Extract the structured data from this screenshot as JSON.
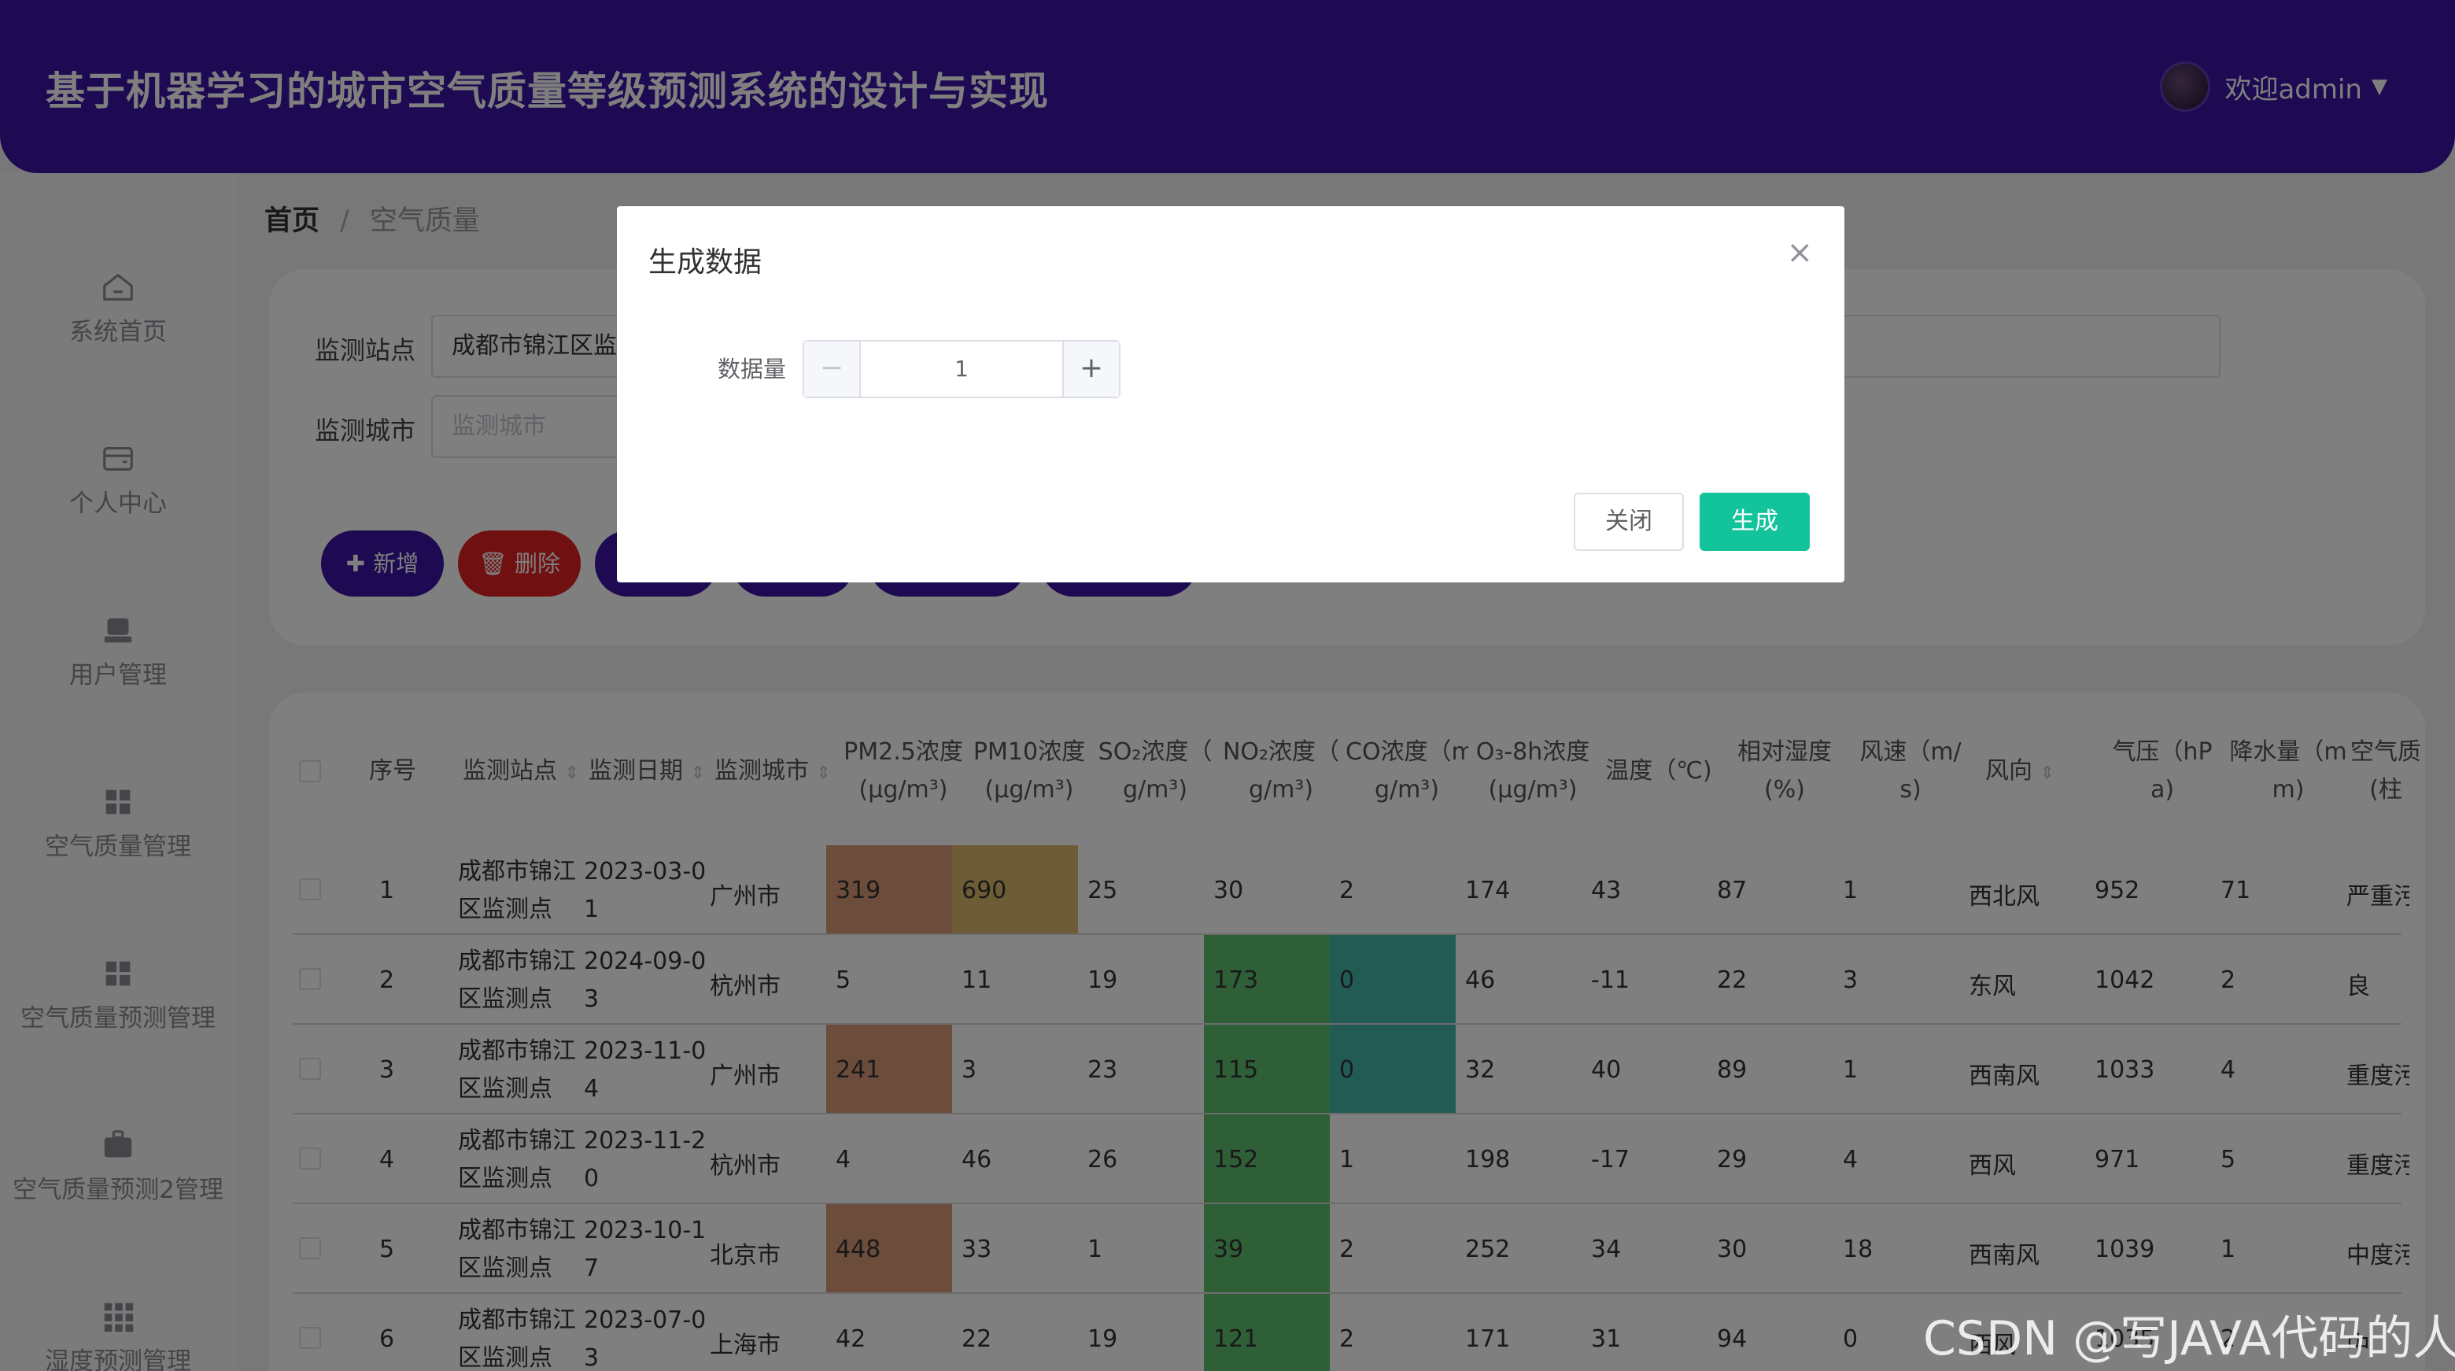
{
  "header": {
    "title": "基于机器学习的城市空气质量等级预测系统的设计与实现",
    "welcome": "欢迎admin",
    "caret": "▼"
  },
  "sidebar": {
    "items": [
      {
        "label": "系统首页",
        "icon": "home-icon"
      },
      {
        "label": "个人中心",
        "icon": "wallet-icon"
      },
      {
        "label": "用户管理",
        "icon": "user-icon"
      },
      {
        "label": "空气质量管理",
        "icon": "grid-icon"
      },
      {
        "label": "空气质量预测管理",
        "icon": "grid-icon"
      },
      {
        "label": "空气质量预测2管理",
        "icon": "briefcase-icon"
      },
      {
        "label": "湿度预测管理",
        "icon": "apps-icon"
      }
    ]
  },
  "breadcrumb": {
    "home": "首页",
    "sep": "/",
    "current": "空气质量"
  },
  "search": {
    "station_label": "监测站点",
    "station_value": "成都市锦江区监测点",
    "city_label": "监测城市",
    "city_placeholder": "监测城市"
  },
  "toolbar": {
    "add": "新增",
    "delete": "删除"
  },
  "table": {
    "headers": [
      "序号",
      "监测站点",
      "监测日期",
      "监测城市",
      "PM2.5浓度",
      "(μg/m³)",
      "PM10浓度",
      "(μg/m³)",
      "SO₂浓度（",
      "g/m³)",
      "NO₂浓度（",
      "g/m³)",
      "CO浓度（m",
      "g/m³)",
      "O₃-8h浓度",
      "(μg/m³)",
      "温度（℃)",
      "相对湿度",
      "(%)",
      "风速（m/",
      "s)",
      "风向",
      "气压（hP",
      "a)",
      "降水量（m",
      "m)",
      "空气质",
      "(柱"
    ],
    "rows": [
      {
        "no": "1",
        "station1": "成都市锦江",
        "station2": "区监测点",
        "date1": "2023-03-0",
        "date2": "1",
        "city": "广州市",
        "pm25": "319",
        "pm10": "690",
        "so2": "25",
        "no2": "30",
        "co": "2",
        "o3": "174",
        "temp": "43",
        "hum": "87",
        "wind": "1",
        "dir": "西北风",
        "pres": "952",
        "rain": "71",
        "aqi": "严重污"
      },
      {
        "no": "2",
        "station1": "成都市锦江",
        "station2": "区监测点",
        "date1": "2024-09-0",
        "date2": "3",
        "city": "杭州市",
        "pm25": "5",
        "pm10": "11",
        "so2": "19",
        "no2": "173",
        "co": "0",
        "o3": "46",
        "temp": "-11",
        "hum": "22",
        "wind": "3",
        "dir": "东风",
        "pres": "1042",
        "rain": "2",
        "aqi": "良"
      },
      {
        "no": "3",
        "station1": "成都市锦江",
        "station2": "区监测点",
        "date1": "2023-11-0",
        "date2": "4",
        "city": "广州市",
        "pm25": "241",
        "pm10": "3",
        "so2": "23",
        "no2": "115",
        "co": "0",
        "o3": "32",
        "temp": "40",
        "hum": "89",
        "wind": "1",
        "dir": "西南风",
        "pres": "1033",
        "rain": "4",
        "aqi": "重度污"
      },
      {
        "no": "4",
        "station1": "成都市锦江",
        "station2": "区监测点",
        "date1": "2023-11-2",
        "date2": "0",
        "city": "杭州市",
        "pm25": "4",
        "pm10": "46",
        "so2": "26",
        "no2": "152",
        "co": "1",
        "o3": "198",
        "temp": "-17",
        "hum": "29",
        "wind": "4",
        "dir": "西风",
        "pres": "971",
        "rain": "5",
        "aqi": "重度污"
      },
      {
        "no": "5",
        "station1": "成都市锦江",
        "station2": "区监测点",
        "date1": "2023-10-1",
        "date2": "7",
        "city": "北京市",
        "pm25": "448",
        "pm10": "33",
        "so2": "1",
        "no2": "39",
        "co": "2",
        "o3": "252",
        "temp": "34",
        "hum": "30",
        "wind": "18",
        "dir": "西南风",
        "pres": "1039",
        "rain": "1",
        "aqi": "中度污"
      },
      {
        "no": "6",
        "station1": "成都市锦江",
        "station2": "区监测点",
        "date1": "2023-07-0",
        "date2": "3",
        "city": "上海市",
        "pm25": "42",
        "pm10": "22",
        "so2": "19",
        "no2": "121",
        "co": "2",
        "o3": "171",
        "temp": "31",
        "hum": "94",
        "wind": "0",
        "dir": "西风",
        "pres": "1035",
        "rain": "2",
        "aqi": "中"
      }
    ]
  },
  "colors": {
    "header": "#3a14a4",
    "primary_button": "#13c39b",
    "danger": "#e02020",
    "pm_high": "#d99977",
    "pm10_high": "#ddb96d",
    "no2_high": "#5fbf6e",
    "co_low": "#45b6a9"
  },
  "dialog": {
    "title": "生成数据",
    "close": "×",
    "field_label": "数据量",
    "minus": "−",
    "plus": "+",
    "value": "1",
    "close_button": "关闭",
    "generate_button": "生成"
  },
  "watermark": "CSDN @写JAVA代码的人"
}
